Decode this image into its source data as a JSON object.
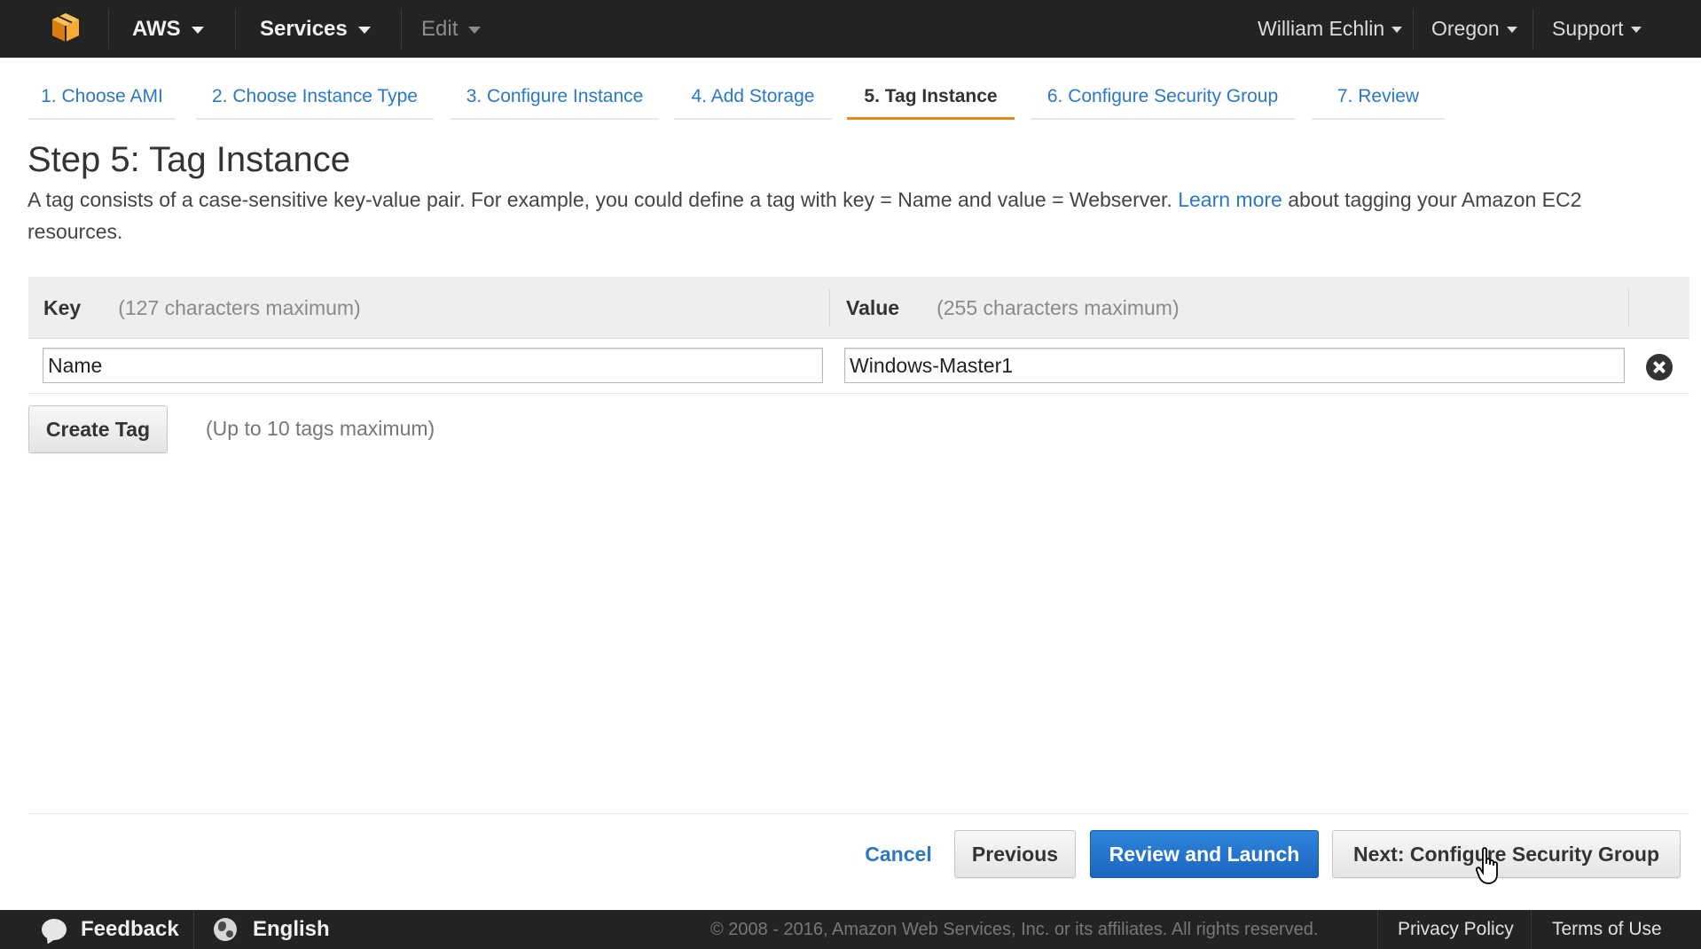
{
  "nav": {
    "aws_label": "AWS",
    "services_label": "Services",
    "edit_label": "Edit",
    "user_label": "William Echlin",
    "region_label": "Oregon",
    "support_label": "Support"
  },
  "wizard": {
    "tabs": [
      {
        "label": "1. Choose AMI",
        "active": false
      },
      {
        "label": "2. Choose Instance Type",
        "active": false
      },
      {
        "label": "3. Configure Instance",
        "active": false
      },
      {
        "label": "4. Add Storage",
        "active": false
      },
      {
        "label": "5. Tag Instance",
        "active": true
      },
      {
        "label": "6. Configure Security Group",
        "active": false
      },
      {
        "label": "7. Review",
        "active": false
      }
    ]
  },
  "page": {
    "title": "Step 5: Tag Instance",
    "description_before": "A tag consists of a case-sensitive key-value pair. For example, you could define a tag with key = Name and value = Webserver. ",
    "learn_more": "Learn more",
    "description_after": " about tagging your Amazon EC2 resources."
  },
  "tags": {
    "key_header": "Key",
    "key_hint": "(127 characters maximum)",
    "value_header": "Value",
    "value_hint": "(255 characters maximum)",
    "rows": [
      {
        "key": "Name",
        "value": "Windows-Master1"
      }
    ],
    "create_label": "Create Tag",
    "limit_hint": "(Up to 10 tags maximum)"
  },
  "actions": {
    "cancel": "Cancel",
    "previous": "Previous",
    "review_launch": "Review and Launch",
    "next": "Next: Configure Security Group"
  },
  "footer": {
    "feedback": "Feedback",
    "language": "English",
    "copyright": "© 2008 - 2016, Amazon Web Services, Inc. or its affiliates. All rights reserved.",
    "privacy": "Privacy Policy",
    "terms": "Terms of Use"
  },
  "colors": {
    "nav_bg": "#232323",
    "link": "#2b78c5",
    "active_tab_underline": "#e58a1f",
    "primary_button": "#1c66c2"
  }
}
